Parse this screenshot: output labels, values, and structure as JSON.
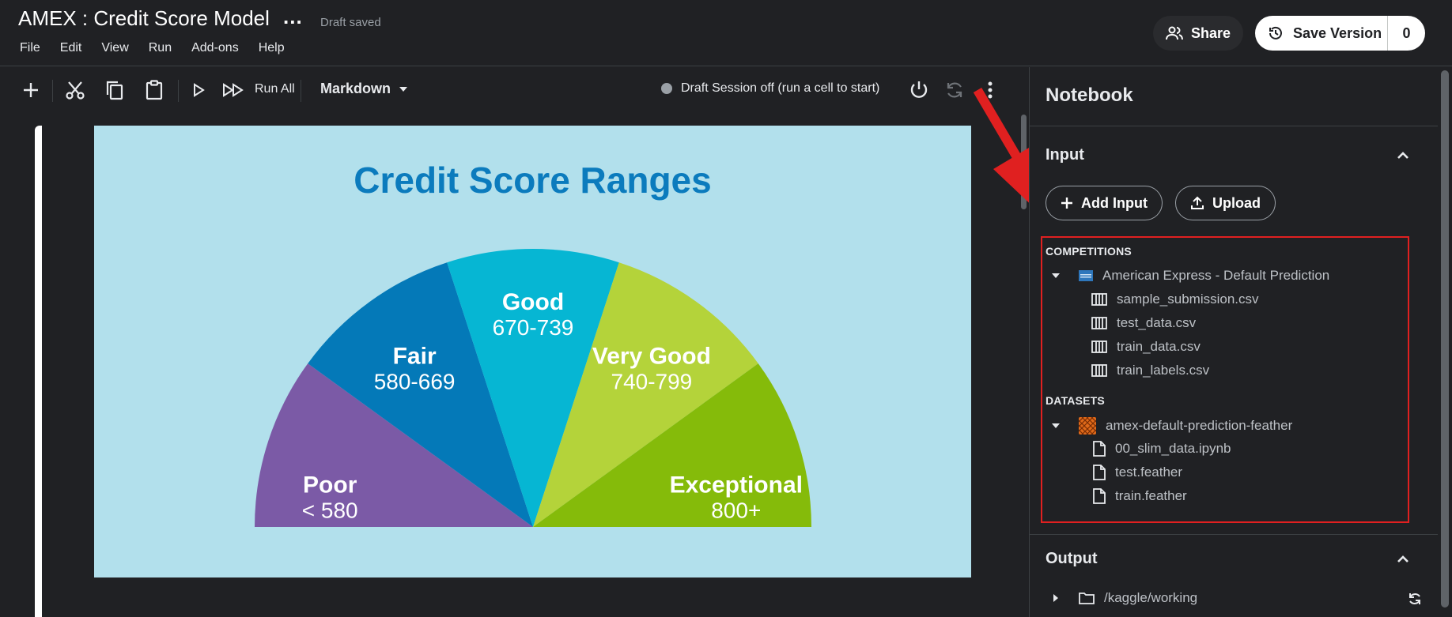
{
  "header": {
    "title": "AMEX : Credit Score Model",
    "title_more": "...",
    "draft_status": "Draft saved",
    "menu": [
      "File",
      "Edit",
      "View",
      "Run",
      "Add-ons",
      "Help"
    ],
    "share_label": "Share",
    "save_version_label": "Save Version",
    "save_version_count": "0"
  },
  "toolbar": {
    "icons": [
      "add-icon",
      "cut-icon",
      "copy-icon",
      "paste-icon",
      "run-icon",
      "run-all-icon"
    ],
    "run_all_label": "Run All",
    "cell_type": "Markdown",
    "session_status": "Draft Session off (run a cell to start)",
    "session_dot_color": "#9aa0a6"
  },
  "cell_image": {
    "title": "Credit Score Ranges",
    "background": "#b2e0ec",
    "title_color": "#0b7bbd",
    "segments": [
      {
        "label": "Poor",
        "range": "< 580",
        "color": "#7b5aa6"
      },
      {
        "label": "Fair",
        "range": "580-669",
        "color": "#0479b8"
      },
      {
        "label": "Good",
        "range": "670-739",
        "color": "#06b6d3"
      },
      {
        "label": "Very Good",
        "range": "740-799",
        "color": "#b4d33a"
      },
      {
        "label": "Exceptional",
        "range": "800+",
        "color": "#85bb0a"
      }
    ]
  },
  "sidebar": {
    "heading": "Notebook",
    "input": {
      "label": "Input",
      "add_input_label": "Add Input",
      "upload_label": "Upload",
      "competitions_label": "COMPETITIONS",
      "competition_name": "American Express - Default Prediction",
      "competition_files": [
        "sample_submission.csv",
        "test_data.csv",
        "train_data.csv",
        "train_labels.csv"
      ],
      "datasets_label": "DATASETS",
      "dataset_name": "amex-default-prediction-feather",
      "dataset_files": [
        "00_slim_data.ipynb",
        "test.feather",
        "train.feather"
      ]
    },
    "output": {
      "label": "Output",
      "folder": "/kaggle/working"
    }
  },
  "annotation": {
    "arrow_color": "#e02020",
    "highlight_color": "#e02020"
  }
}
